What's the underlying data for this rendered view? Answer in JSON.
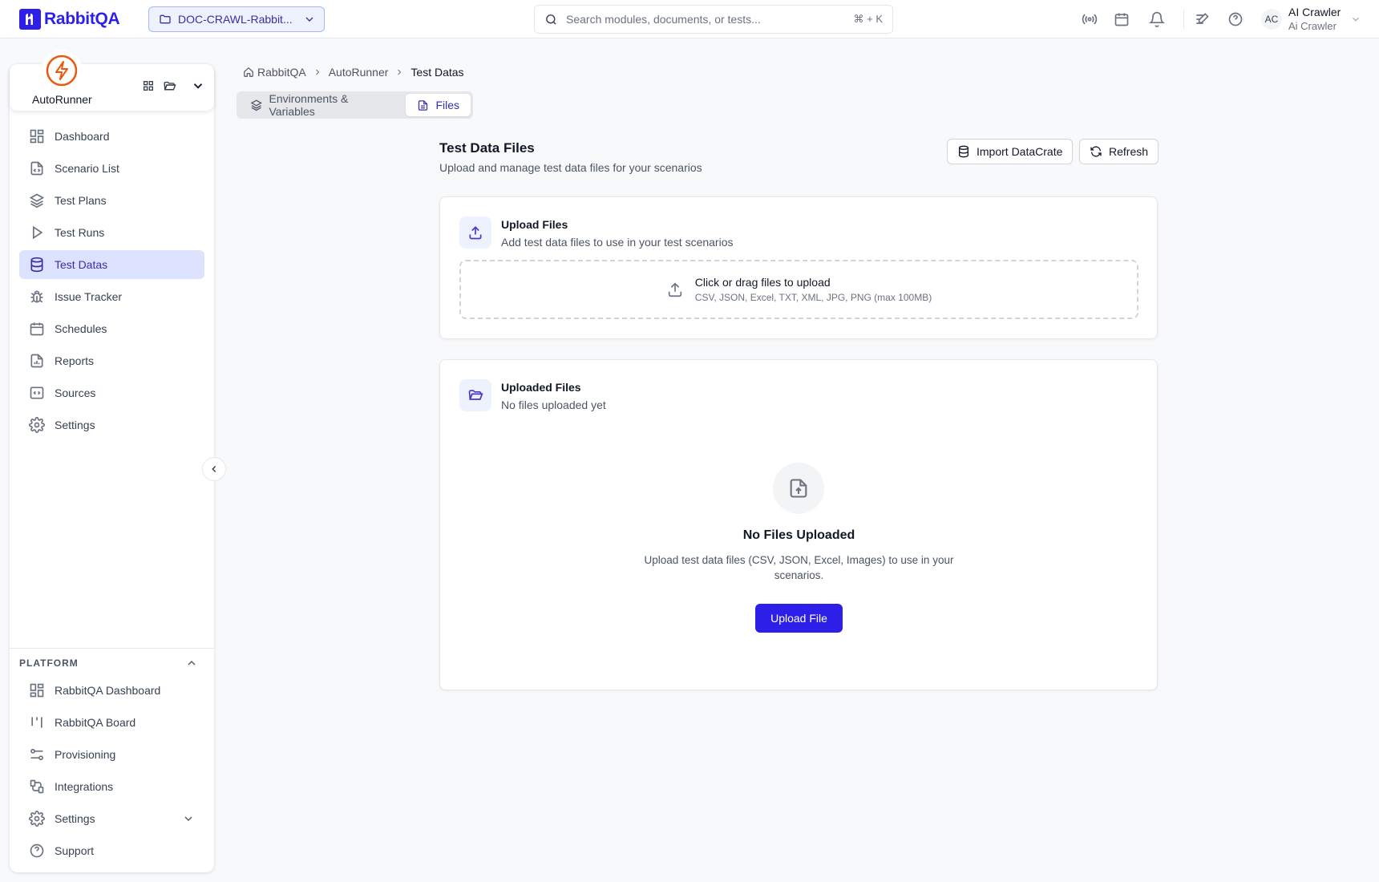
{
  "app": {
    "name": "RabbitQA",
    "brand_color": "#2d1fe8"
  },
  "project_selector": {
    "label": "DOC-CRAWL-Rabbit..."
  },
  "search": {
    "placeholder": "Search modules, documents, or tests...",
    "shortcut": "⌘ + K"
  },
  "user": {
    "initials": "AC",
    "name": "AI Crawler",
    "role": "Ai Crawler"
  },
  "module": {
    "name": "AutoRunner",
    "accent": "#ea580c"
  },
  "sidebar": {
    "items": [
      {
        "label": "Dashboard",
        "icon": "dashboard-icon"
      },
      {
        "label": "Scenario List",
        "icon": "file-code-icon"
      },
      {
        "label": "Test Plans",
        "icon": "layers-icon"
      },
      {
        "label": "Test Runs",
        "icon": "play-icon"
      },
      {
        "label": "Test Datas",
        "icon": "database-icon",
        "active": true
      },
      {
        "label": "Issue Tracker",
        "icon": "bug-icon"
      },
      {
        "label": "Schedules",
        "icon": "calendar-icon"
      },
      {
        "label": "Reports",
        "icon": "report-icon"
      },
      {
        "label": "Sources",
        "icon": "code-icon"
      },
      {
        "label": "Settings",
        "icon": "gear-icon"
      }
    ],
    "platform_heading": "PLATFORM",
    "platform_items": [
      {
        "label": "RabbitQA Dashboard",
        "icon": "dashboard-icon"
      },
      {
        "label": "RabbitQA Board",
        "icon": "board-icon"
      },
      {
        "label": "Provisioning",
        "icon": "provisioning-icon"
      },
      {
        "label": "Integrations",
        "icon": "integrations-icon"
      },
      {
        "label": "Settings",
        "icon": "gear-icon"
      },
      {
        "label": "Support",
        "icon": "help-icon"
      }
    ]
  },
  "breadcrumb": {
    "home": "RabbitQA",
    "module": "AutoRunner",
    "current": "Test Datas"
  },
  "tabs": [
    {
      "label": "Environments & Variables",
      "icon": "layers-icon"
    },
    {
      "label": "Files",
      "icon": "file-icon",
      "active": true
    }
  ],
  "page": {
    "title": "Test Data Files",
    "subtitle": "Upload and manage test data files for your scenarios",
    "import_label": "Import DataCrate",
    "refresh_label": "Refresh"
  },
  "upload_card": {
    "title": "Upload Files",
    "subtitle": "Add test data files to use in your test scenarios",
    "drop_text": "Click or drag files to upload",
    "drop_hint": "CSV, JSON, Excel, TXT, XML, JPG, PNG (max 100MB)"
  },
  "uploaded_card": {
    "title": "Uploaded Files",
    "subtitle": "No files uploaded yet",
    "empty_title": "No Files Uploaded",
    "empty_text": "Upload test data files (CSV, JSON, Excel, Images) to use in your scenarios.",
    "button_label": "Upload File"
  }
}
